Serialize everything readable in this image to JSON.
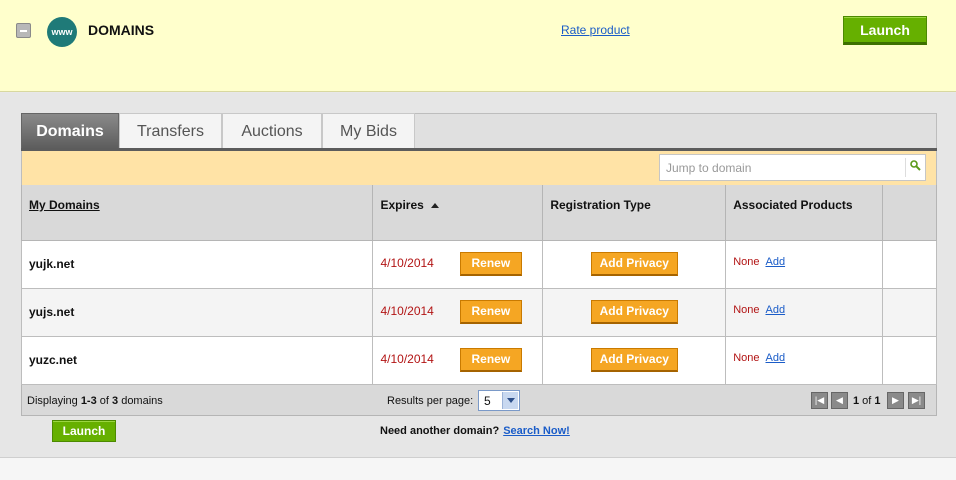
{
  "header": {
    "www_icon_text": "www",
    "title": "DOMAINS",
    "rate_link": "Rate product",
    "launch_label": "Launch"
  },
  "tabs": [
    {
      "label": "Domains",
      "active": true
    },
    {
      "label": "Transfers",
      "active": false
    },
    {
      "label": "Auctions",
      "active": false
    },
    {
      "label": "My Bids",
      "active": false
    }
  ],
  "jump": {
    "placeholder": "Jump to domain"
  },
  "table": {
    "columns": [
      "My Domains",
      "Expires",
      "Registration Type",
      "Associated Products"
    ],
    "rows": [
      {
        "domain": "yujk.net",
        "expires": "4/10/2014",
        "renew": "Renew",
        "privacy": "Add Privacy",
        "products": "None",
        "add": "Add"
      },
      {
        "domain": "yujs.net",
        "expires": "4/10/2014",
        "renew": "Renew",
        "privacy": "Add Privacy",
        "products": "None",
        "add": "Add"
      },
      {
        "domain": "yuzc.net",
        "expires": "4/10/2014",
        "renew": "Renew",
        "privacy": "Add Privacy",
        "products": "None",
        "add": "Add"
      }
    ]
  },
  "footer": {
    "display_prefix": "Displaying ",
    "display_range": "1-3",
    "display_of": " of ",
    "display_total": "3",
    "display_suffix": " domains",
    "results_per_page_label": "Results per page:",
    "results_per_page_value": "5",
    "page_current": "1",
    "page_of": " of ",
    "page_total": "1"
  },
  "bottom_bar": {
    "launch_label": "Launch",
    "need_more": "Need another domain?",
    "search_now": "Search Now!"
  },
  "colors": {
    "header_bg": "#ffffcc",
    "launch_green": "#66b000",
    "action_orange": "#f5a623",
    "expires_red": "#b21414",
    "link_blue": "#1a5cc8"
  }
}
